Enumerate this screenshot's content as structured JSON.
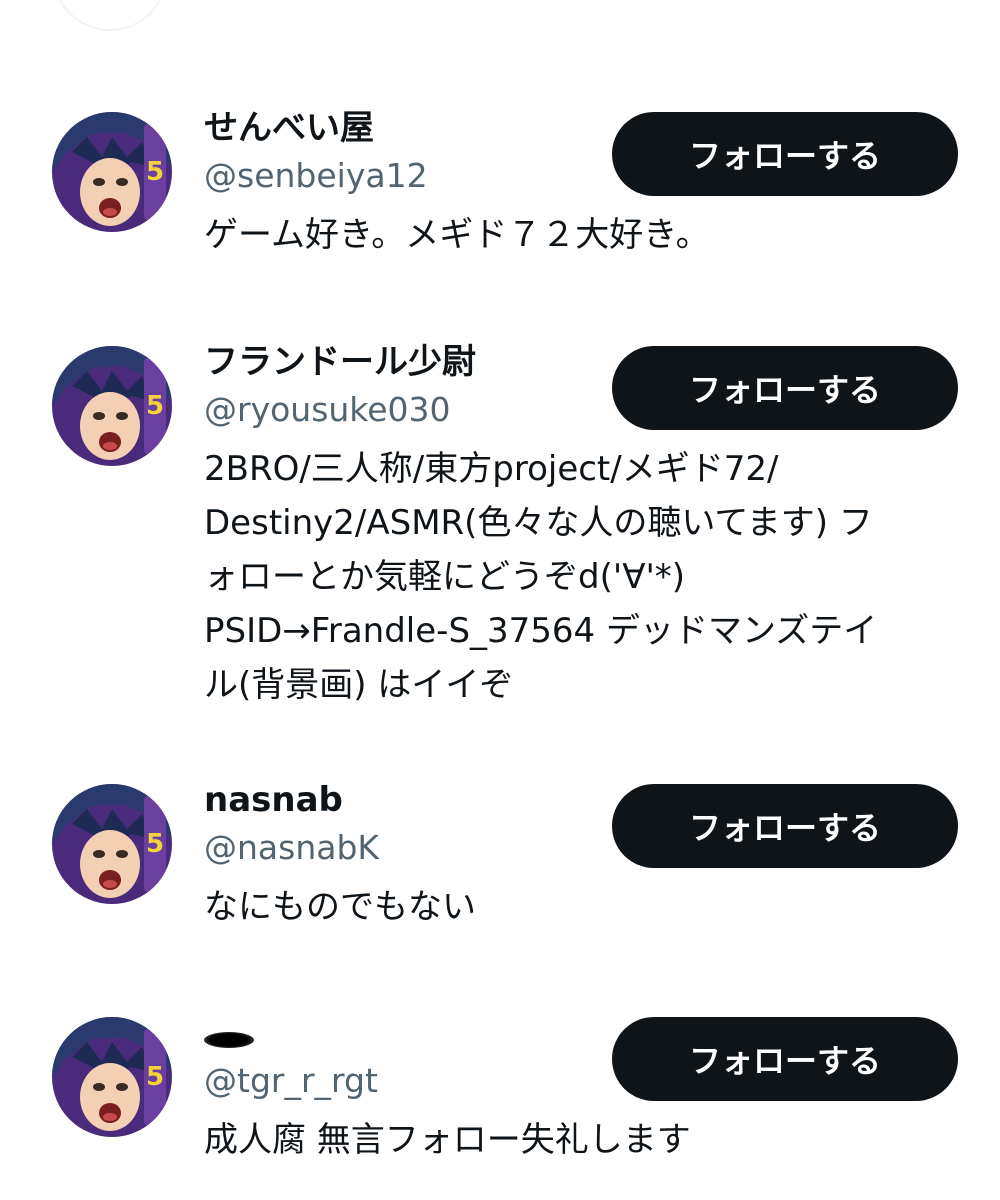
{
  "colors": {
    "button_bg": "#0f1419",
    "button_text": "#ffffff",
    "handle": "#536471",
    "avatar_purple": "#5a2d8c",
    "avatar_hair": "#2b3a6e"
  },
  "users": [
    {
      "display_name": "せんべい屋",
      "handle": "@senbeiya12",
      "bio": "ゲーム好き。メギド７２大好き。",
      "follow_label": "フォローする",
      "avatar_icon": "anime-character-avatar"
    },
    {
      "display_name": "フランドール少尉",
      "handle": "@ryousuke030",
      "bio": "2BRO/三人称/東方project/メギド72/\nDestiny2/ASMR(色々な人の聴いてます) フ\nォローとか気軽にどうぞd('∀'*)\nPSID→Frandle-S_37564 デッドマンズテイ\nル(背景画) はイイぞ",
      "follow_label": "フォローする",
      "avatar_icon": "anime-character-avatar"
    },
    {
      "display_name": "nasnab",
      "handle": "@nasnabK",
      "bio": "なにものでもない",
      "follow_label": "フォローする",
      "avatar_icon": "anime-character-avatar"
    },
    {
      "display_name": "",
      "display_name_icon": "hole-icon",
      "handle": "@tgr_r_rgt",
      "bio": "成人腐 無言フォロー失礼します",
      "follow_label": "フォローする",
      "avatar_icon": "anime-character-avatar"
    }
  ]
}
